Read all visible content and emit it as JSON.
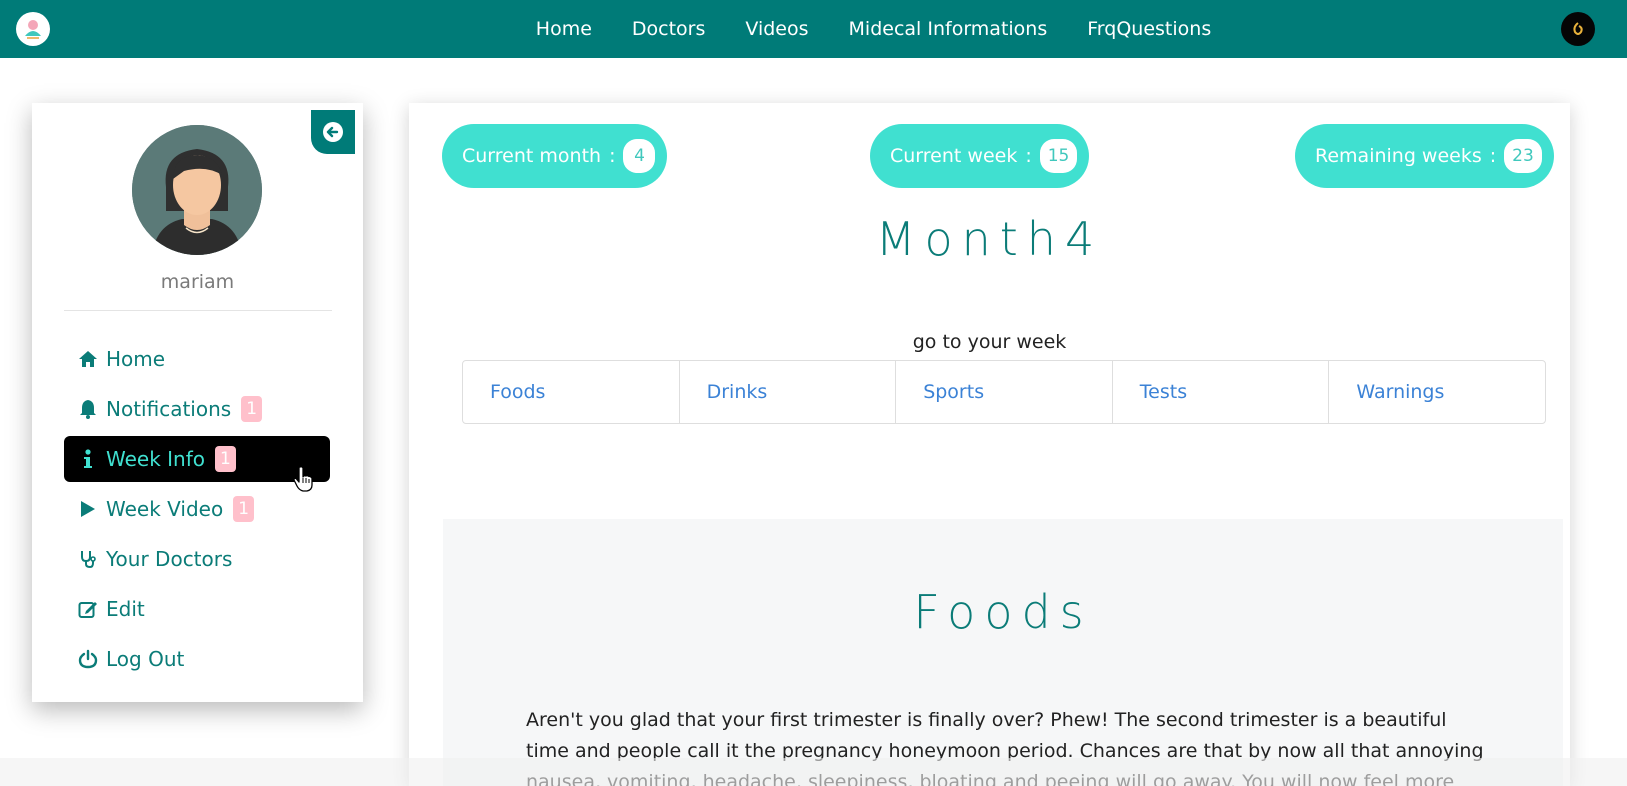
{
  "navbar": {
    "links": [
      "Home",
      "Doctors",
      "Videos",
      "Midecal Informations",
      "FrqQuestions"
    ],
    "colors": {
      "bar": "#007b78",
      "text": "#ffffff"
    },
    "logo_icon": "app-logo-icon",
    "profile_icon": "profile-icon"
  },
  "sidebar": {
    "back_icon": "arrow-left-icon",
    "avatar_icon": "woman-avatar-icon",
    "username": "mariam",
    "items": [
      {
        "label": "Home",
        "icon": "home-icon",
        "badge": null,
        "active": false
      },
      {
        "label": "Notifications",
        "icon": "bell-icon",
        "badge": "1",
        "active": false
      },
      {
        "label": "Week Info",
        "icon": "info-icon",
        "badge": "1",
        "active": true
      },
      {
        "label": "Week Video",
        "icon": "play-icon",
        "badge": "1",
        "active": false
      },
      {
        "label": "Your Doctors",
        "icon": "stethoscope-icon",
        "badge": null,
        "active": false
      },
      {
        "label": "Edit",
        "icon": "edit-icon",
        "badge": null,
        "active": false
      },
      {
        "label": "Log Out",
        "icon": "power-icon",
        "badge": null,
        "active": false
      }
    ],
    "colors": {
      "item_text": "#0b7c78",
      "active_bg": "#000000",
      "active_text": "#40e0d0",
      "badge_bg": "#ffc0cb"
    }
  },
  "main": {
    "stats": [
      {
        "label": "Current month",
        "sep": ":",
        "value": "4"
      },
      {
        "label": "Current week",
        "sep": ":",
        "value": "15"
      },
      {
        "label": "Remaining weeks",
        "sep": ":",
        "value": "23"
      }
    ],
    "month_title": "Month4",
    "go_to_week": "go to your week",
    "tabs": [
      "Foods",
      "Drinks",
      "Sports",
      "Tests",
      "Warnings"
    ],
    "section_title": "Foods",
    "section_text": "Aren't you glad that your first trimester is finally over? Phew! The second trimester is a beautiful time and people call it the pregnancy honeymoon period. Chances are that by now all that annoying nausea, vomiting, headache, sleepiness, bloating and peeing will go away. You will now feel more",
    "colors": {
      "pill_bg": "#40e0d0",
      "title": "#0b7c78",
      "tab_link": "#3b82d6"
    }
  }
}
